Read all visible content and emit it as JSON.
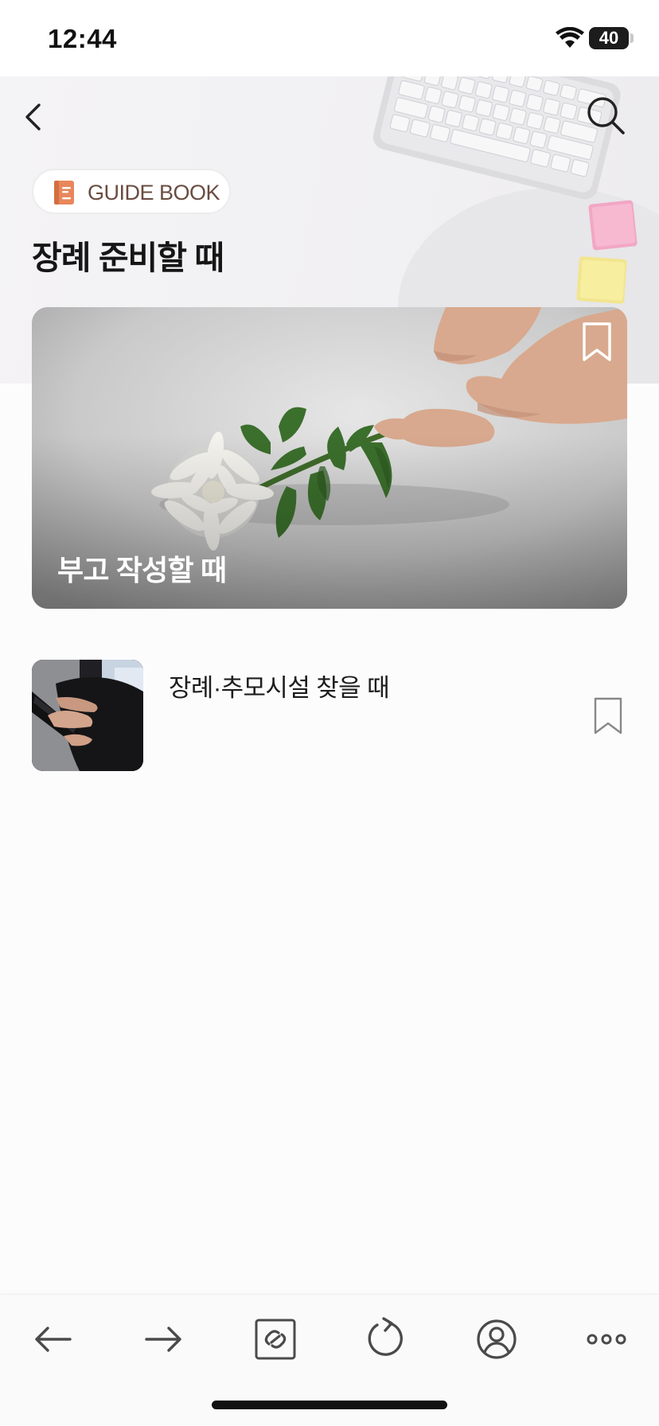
{
  "status_bar": {
    "time": "12:44",
    "battery_level": "40"
  },
  "header": {
    "badge_label": "GUIDE BOOK",
    "title": "장례 준비할 때"
  },
  "featured": {
    "title": "부고 작성할 때",
    "bookmarked": true
  },
  "list": [
    {
      "title": "장례·추모시설 찾을 때",
      "bookmarked": false
    }
  ],
  "colors": {
    "badge_text": "#6a4c40",
    "badge_icon": "#e8875c",
    "title_text": "#161616",
    "toolbar_icon": "#4a4a4a"
  },
  "toolbar": {
    "icons": [
      "arrow-left-icon",
      "arrow-right-icon",
      "link-icon",
      "refresh-icon",
      "profile-icon",
      "more-icon"
    ]
  }
}
